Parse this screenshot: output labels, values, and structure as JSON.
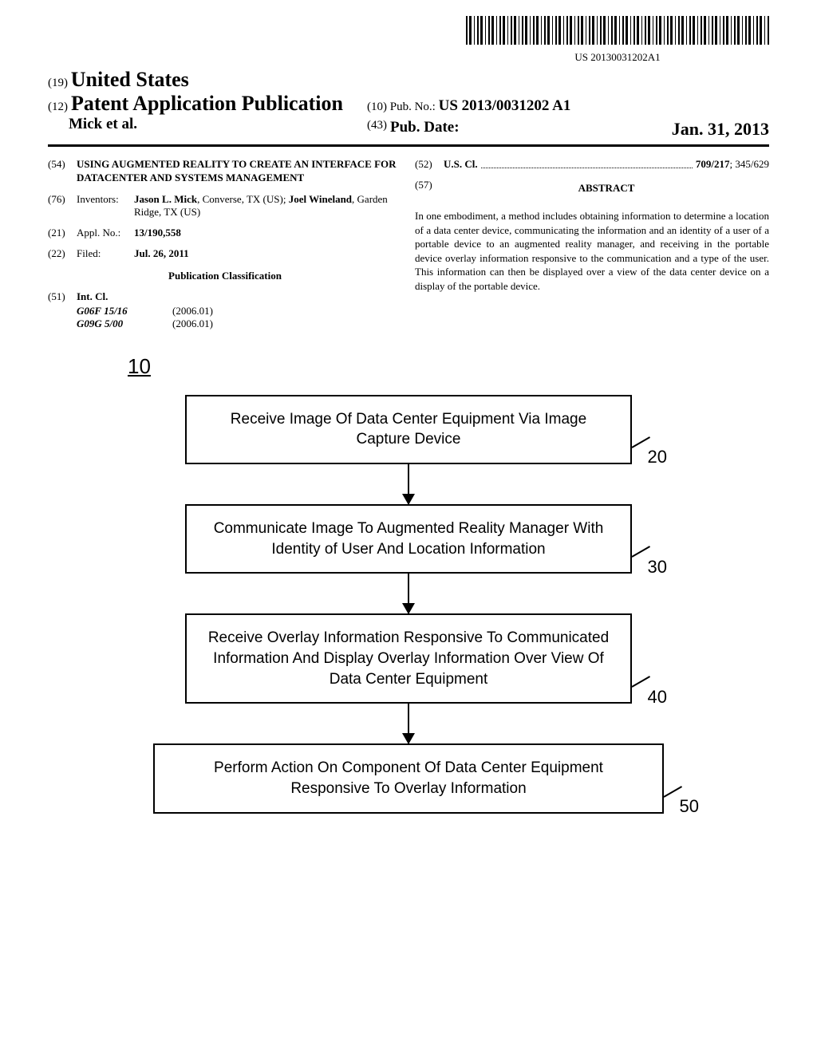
{
  "barcode_text": "US 20130031202A1",
  "header": {
    "line1_num": "(19)",
    "line1_country": "United States",
    "line2_num": "(12)",
    "line2_doctype": "Patent Application Publication",
    "authors": "Mick et al.",
    "pub_no_num": "(10)",
    "pub_no_label": "Pub. No.:",
    "pub_no_value": "US 2013/0031202 A1",
    "pub_date_num": "(43)",
    "pub_date_label": "Pub. Date:",
    "pub_date_value": "Jan. 31, 2013"
  },
  "fields": {
    "title_num": "(54)",
    "title": "USING AUGMENTED REALITY TO CREATE AN INTERFACE FOR DATACENTER AND SYSTEMS MANAGEMENT",
    "inventors_num": "(76)",
    "inventors_label": "Inventors:",
    "inventors_html_prefix1": "Jason L. Mick",
    "inventors_loc1": ", Converse, TX (US); ",
    "inventors_name2": "Joel Wineland",
    "inventors_loc2": ", Garden Ridge, TX (US)",
    "appl_num": "(21)",
    "appl_label": "Appl. No.:",
    "appl_value": "13/190,558",
    "filed_num": "(22)",
    "filed_label": "Filed:",
    "filed_value": "Jul. 26, 2011",
    "pub_class_heading": "Publication Classification",
    "intcl_num": "(51)",
    "intcl_label": "Int. Cl.",
    "intcl_rows": [
      {
        "code": "G06F 15/16",
        "year": "(2006.01)"
      },
      {
        "code": "G09G 5/00",
        "year": "(2006.01)"
      }
    ],
    "uscl_num": "(52)",
    "uscl_label": "U.S. Cl.",
    "uscl_bold": "709/217",
    "uscl_rest": "; 345/629",
    "abstract_num": "(57)",
    "abstract_heading": "ABSTRACT",
    "abstract_text": "In one embodiment, a method includes obtaining information to determine a location of a data center device, communicating the information and an identity of a user of a portable device to an augmented reality manager, and receiving in the portable device overlay information responsive to the communication and a type of the user. This information can then be displayed over a view of the data center device on a display of the portable device."
  },
  "figure": {
    "ref_num": "10",
    "boxes": [
      {
        "text": "Receive Image Of Data Center Equipment Via Image Capture Device",
        "ref": "20"
      },
      {
        "text": "Communicate Image To Augmented Reality Manager With Identity of User And Location Information",
        "ref": "30"
      },
      {
        "text": "Receive Overlay Information Responsive To Communicated Information And Display Overlay Information Over View Of Data Center Equipment",
        "ref": "40"
      },
      {
        "text": "Perform Action On Component Of Data Center Equipment Responsive To Overlay Information",
        "ref": "50"
      }
    ]
  }
}
